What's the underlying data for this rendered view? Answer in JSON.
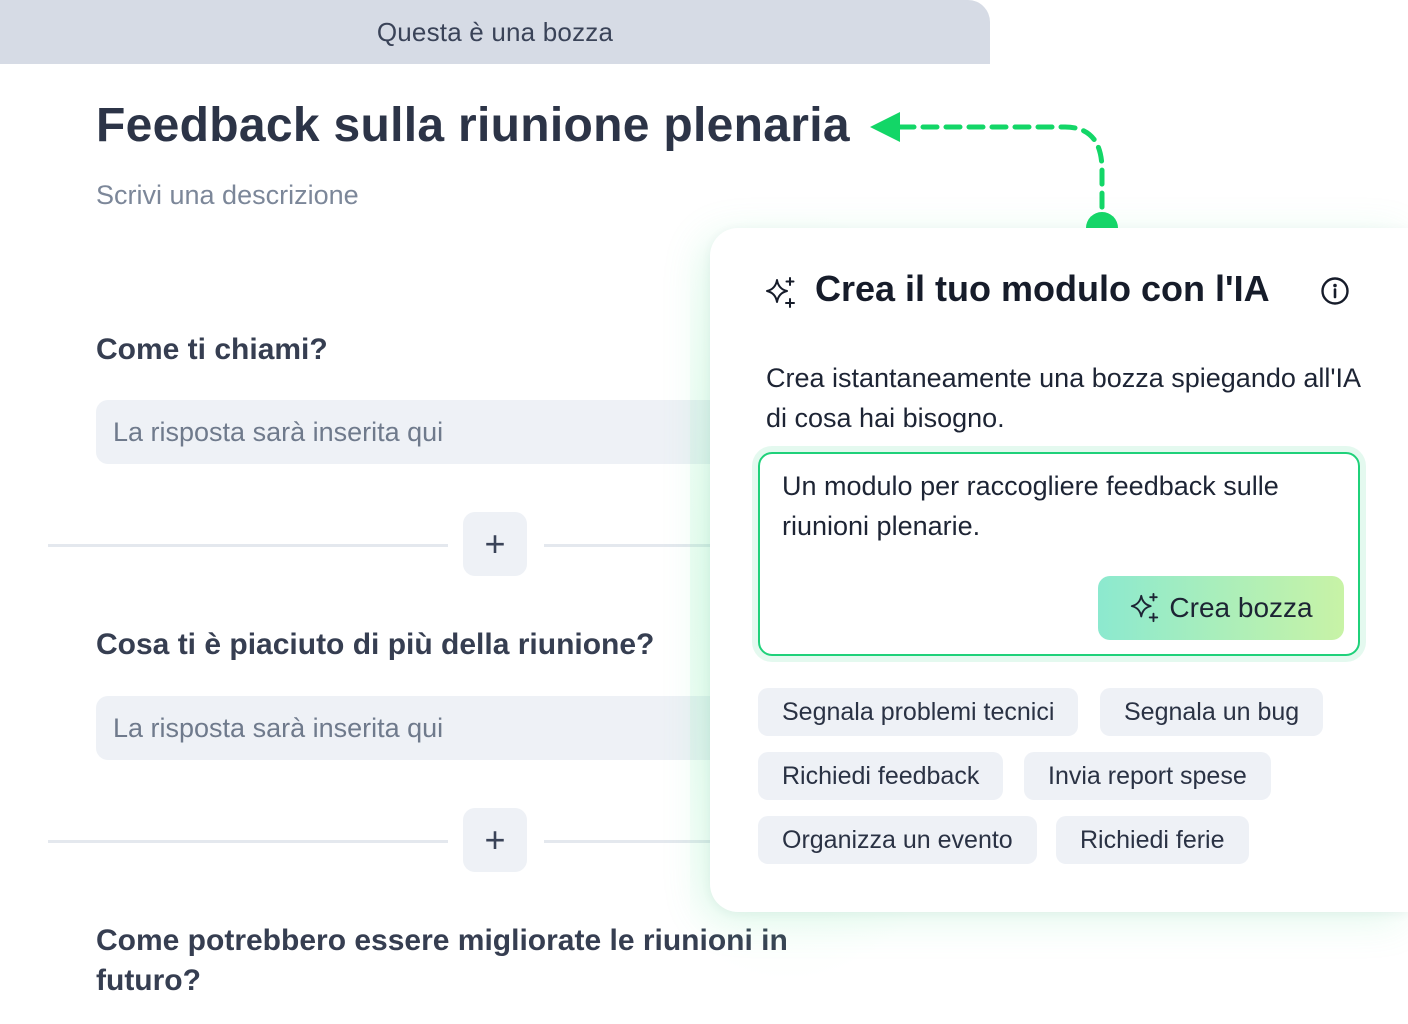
{
  "form": {
    "draft_banner": "Questa è una bozza",
    "title": "Feedback sulla riunione plenaria",
    "description_placeholder": "Scrivi una descrizione",
    "questions": [
      {
        "label": "Come ti chiami?",
        "answer_placeholder": "La risposta sarà inserita qui"
      },
      {
        "label": "Cosa ti è piaciuto di più della riunione?",
        "answer_placeholder": "La risposta sarà inserita qui"
      },
      {
        "label": "Come potrebbero essere migliorate le riunioni in futuro?"
      }
    ],
    "add_button_glyph": "+"
  },
  "ai_panel": {
    "title": "Crea il tuo modulo con l'IA",
    "description": "Crea istantaneamente una bozza spiegando all'IA di cosa hai bisogno.",
    "prompt_value": "Un modulo per raccogliere feedback sulle riunioni plenarie.",
    "create_button": "Crea bozza",
    "suggestions": [
      "Segnala problemi tecnici",
      "Segnala un bug",
      "Richiedi feedback",
      "Invia report spese",
      "Organizza un evento",
      "Richiedi ferie"
    ],
    "icons": {
      "title": "sparkle-icon",
      "info": "info-icon",
      "button": "sparkle-icon"
    }
  },
  "colors": {
    "accent_green": "#1fd17a",
    "banner_bg": "#d6dbe5",
    "title_text": "#2c3447",
    "chip_bg": "#eef1f6",
    "button_gradient_start": "#8ce9cf",
    "button_gradient_end": "#c8f3a6"
  }
}
